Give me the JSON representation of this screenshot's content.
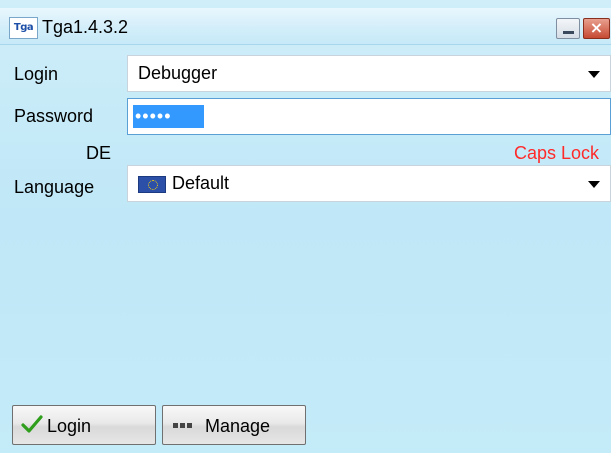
{
  "window": {
    "title": "Tga1.4.3.2",
    "app_icon_text": "Tga"
  },
  "form": {
    "login_label": "Login",
    "login_value": "Debugger",
    "password_label": "Password",
    "password_value": "•••••",
    "keyboard_layout": "DE",
    "caps_lock_warning": "Caps Lock",
    "language_label": "Language",
    "language_value": "Default"
  },
  "buttons": {
    "login": "Login",
    "manage": "Manage"
  },
  "colors": {
    "caps_lock": "#ff2a2a",
    "selection": "#3399ff",
    "background": "#c4ebf8"
  }
}
